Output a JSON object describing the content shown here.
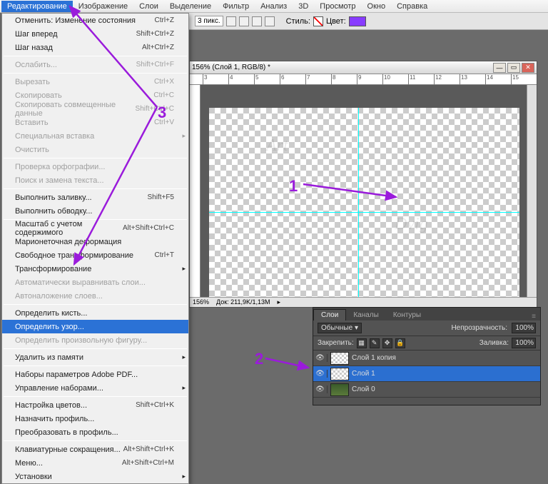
{
  "menubar": [
    "Редактирование",
    "Изображение",
    "Слои",
    "Выделение",
    "Фильтр",
    "Анализ",
    "3D",
    "Просмотр",
    "Окно",
    "Справка"
  ],
  "toolbar": {
    "px_value": "3 пикс.",
    "style_label": "Стиль:",
    "color_label": "Цвет:"
  },
  "menu": {
    "groups": [
      [
        {
          "label": "Отменить: Изменение состояния",
          "sc": "Ctrl+Z"
        },
        {
          "label": "Шаг вперед",
          "sc": "Shift+Ctrl+Z"
        },
        {
          "label": "Шаг назад",
          "sc": "Alt+Ctrl+Z"
        }
      ],
      [
        {
          "label": "Ослабить...",
          "sc": "Shift+Ctrl+F",
          "dis": true
        }
      ],
      [
        {
          "label": "Вырезать",
          "sc": "Ctrl+X",
          "dis": true
        },
        {
          "label": "Скопировать",
          "sc": "Ctrl+C",
          "dis": true
        },
        {
          "label": "Скопировать совмещенные данные",
          "sc": "Shift+Ctrl+C",
          "dis": true
        },
        {
          "label": "Вставить",
          "sc": "Ctrl+V",
          "dis": true
        },
        {
          "label": "Специальная вставка",
          "sub": true,
          "dis": true
        },
        {
          "label": "Очистить",
          "dis": true
        }
      ],
      [
        {
          "label": "Проверка орфографии...",
          "dis": true
        },
        {
          "label": "Поиск и замена текста...",
          "dis": true
        }
      ],
      [
        {
          "label": "Выполнить заливку...",
          "sc": "Shift+F5"
        },
        {
          "label": "Выполнить обводку..."
        }
      ],
      [
        {
          "label": "Масштаб с учетом содержимого",
          "sc": "Alt+Shift+Ctrl+C"
        },
        {
          "label": "Марионеточная деформация"
        },
        {
          "label": "Свободное трансформирование",
          "sc": "Ctrl+T"
        },
        {
          "label": "Трансформирование",
          "sub": true
        },
        {
          "label": "Автоматически выравнивать слои...",
          "dis": true
        },
        {
          "label": "Автоналожение слоев...",
          "dis": true
        }
      ],
      [
        {
          "label": "Определить кисть..."
        },
        {
          "label": "Определить узор...",
          "sel": true
        },
        {
          "label": "Определить произвольную фигуру...",
          "dis": true
        }
      ],
      [
        {
          "label": "Удалить из памяти",
          "sub": true
        }
      ],
      [
        {
          "label": "Наборы параметров Adobe PDF..."
        },
        {
          "label": "Управление наборами...",
          "sub": true
        }
      ],
      [
        {
          "label": "Настройка цветов...",
          "sc": "Shift+Ctrl+K"
        },
        {
          "label": "Назначить профиль..."
        },
        {
          "label": "Преобразовать в профиль..."
        }
      ],
      [
        {
          "label": "Клавиатурные сокращения...",
          "sc": "Alt+Shift+Ctrl+K"
        },
        {
          "label": "Меню...",
          "sc": "Alt+Shift+Ctrl+M"
        },
        {
          "label": "Установки",
          "sub": true
        }
      ]
    ]
  },
  "doc": {
    "title": "156% (Слой 1, RGB/8) *",
    "zoom": "156%",
    "status": "Док: 211,9K/1,13M"
  },
  "ruler_ticks": [
    "3",
    "4",
    "5",
    "6",
    "7",
    "8",
    "9",
    "10",
    "11",
    "12",
    "13",
    "14",
    "15"
  ],
  "panel": {
    "tabs": [
      "Слои",
      "Каналы",
      "Контуры"
    ],
    "blend": "Обычные",
    "opacity_label": "Непрозрачность:",
    "opacity": "100%",
    "lock_label": "Закрепить:",
    "fill_label": "Заливка:",
    "fill": "100%",
    "layers": [
      {
        "name": "Слой 1 копия"
      },
      {
        "name": "Слой 1",
        "sel": true
      },
      {
        "name": "Слой 0",
        "img": true
      }
    ]
  },
  "anno": {
    "a1": "1",
    "a2": "2",
    "a3": "3"
  }
}
